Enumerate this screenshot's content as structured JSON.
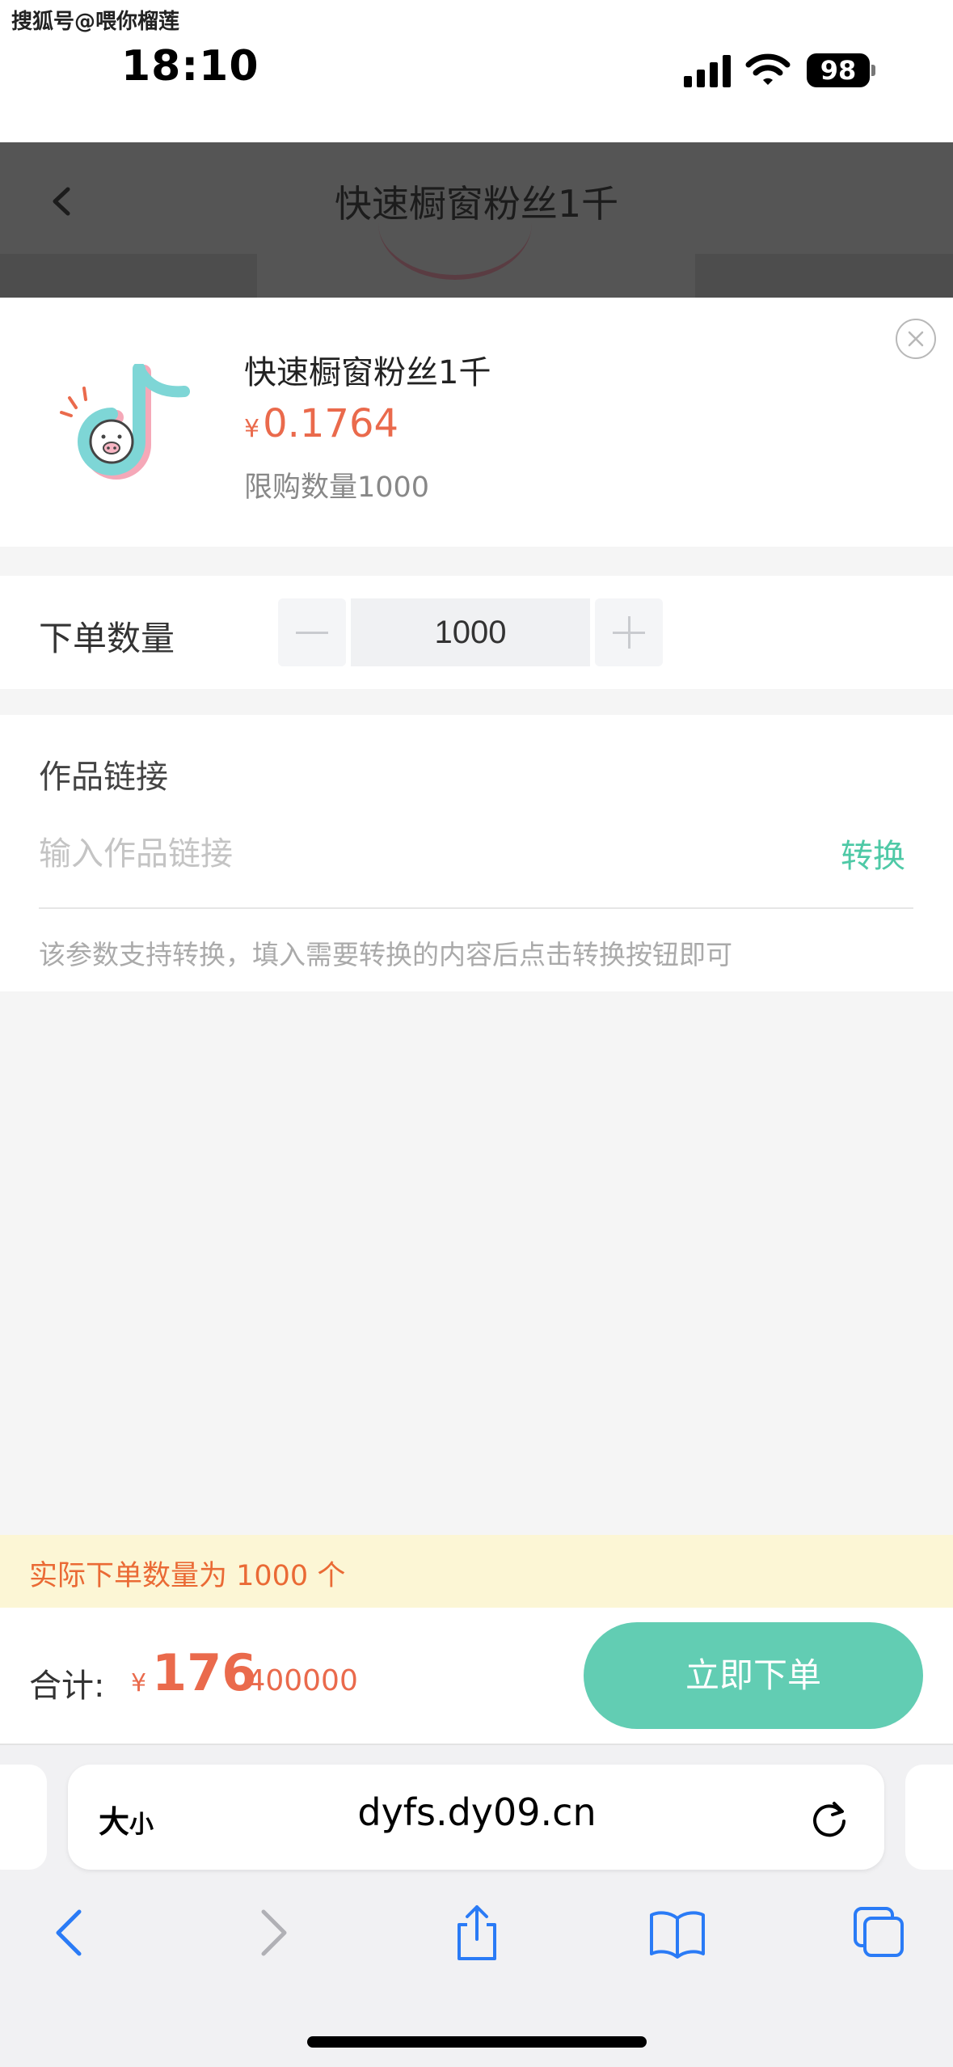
{
  "status_bar": {
    "watermark": "搜狐号@喂你榴莲",
    "time": "18:10",
    "battery": "98"
  },
  "header": {
    "title": "快速橱窗粉丝1千"
  },
  "product": {
    "name": "快速橱窗粉丝1千",
    "currency": "¥",
    "price": "0.1764",
    "limit": "限购数量1000"
  },
  "quantity": {
    "label": "下单数量",
    "value": "1000"
  },
  "link": {
    "label": "作品链接",
    "placeholder": "输入作品链接",
    "convert_label": "转换",
    "hint": "该参数支持转换，填入需要转换的内容后点击转换按钮即可"
  },
  "notice": {
    "text": "实际下单数量为 1000 个"
  },
  "footer": {
    "total_label": "合计:",
    "currency": "¥",
    "total_integer": "176",
    "total_decimal": ".400000",
    "order_label": "立即下单"
  },
  "browser": {
    "size_label_big": "大",
    "size_label_small": "小",
    "url": "dyfs.dy09.cn"
  },
  "colors": {
    "accent": "#62cdb3",
    "price": "#ea6a4c",
    "notice_bg": "#fcf6d5"
  }
}
